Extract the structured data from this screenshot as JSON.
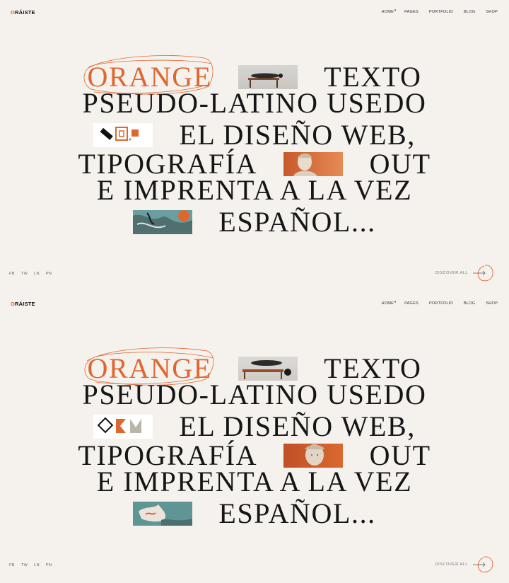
{
  "screens": [
    {
      "logo": {
        "prefix": "O",
        "rest": "RÁISTE"
      },
      "nav": [
        "HOME",
        "PAGES",
        "PORTFOLIO",
        "BLOG",
        "SHOP"
      ],
      "headline": {
        "w1": "ORANGE",
        "w2": "TEXTO",
        "l2": "PSEUDO-LATINO USEDO",
        "w3": "EL DISEÑO WEB,",
        "w4": "TIPOGRAFÍA",
        "w5": "OUT",
        "l5": "E IMPRENTA A LA VEZ",
        "w6": "ESPAÑOL..."
      },
      "socials": [
        "FB",
        "TW",
        "LN",
        "PN"
      ],
      "discover": "DISCOVER ALL"
    },
    {
      "logo": {
        "prefix": "O",
        "rest": "RÁISTE"
      },
      "nav": [
        "HOME",
        "PAGES",
        "PORTFOLIO",
        "BLOG",
        "SHOP"
      ],
      "headline": {
        "w1": "ORANGE",
        "w2": "TEXTO",
        "l2": "PSEUDO-LATINO USEDO",
        "w3": "EL DISEÑO WEB,",
        "w4": "TIPOGRAFÍA",
        "w5": "OUT",
        "l5": "E IMPRENTA A LA VEZ",
        "w6": "ESPAÑOL..."
      },
      "socials": [
        "FB",
        "TW",
        "LN",
        "PN"
      ],
      "discover": "DISCOVER ALL"
    }
  ],
  "colors": {
    "accent": "#e0662f",
    "background": "#f5f2ee",
    "text": "#161616"
  },
  "icons": [
    "arrow-right-icon",
    "circle-scribble-icon"
  ]
}
